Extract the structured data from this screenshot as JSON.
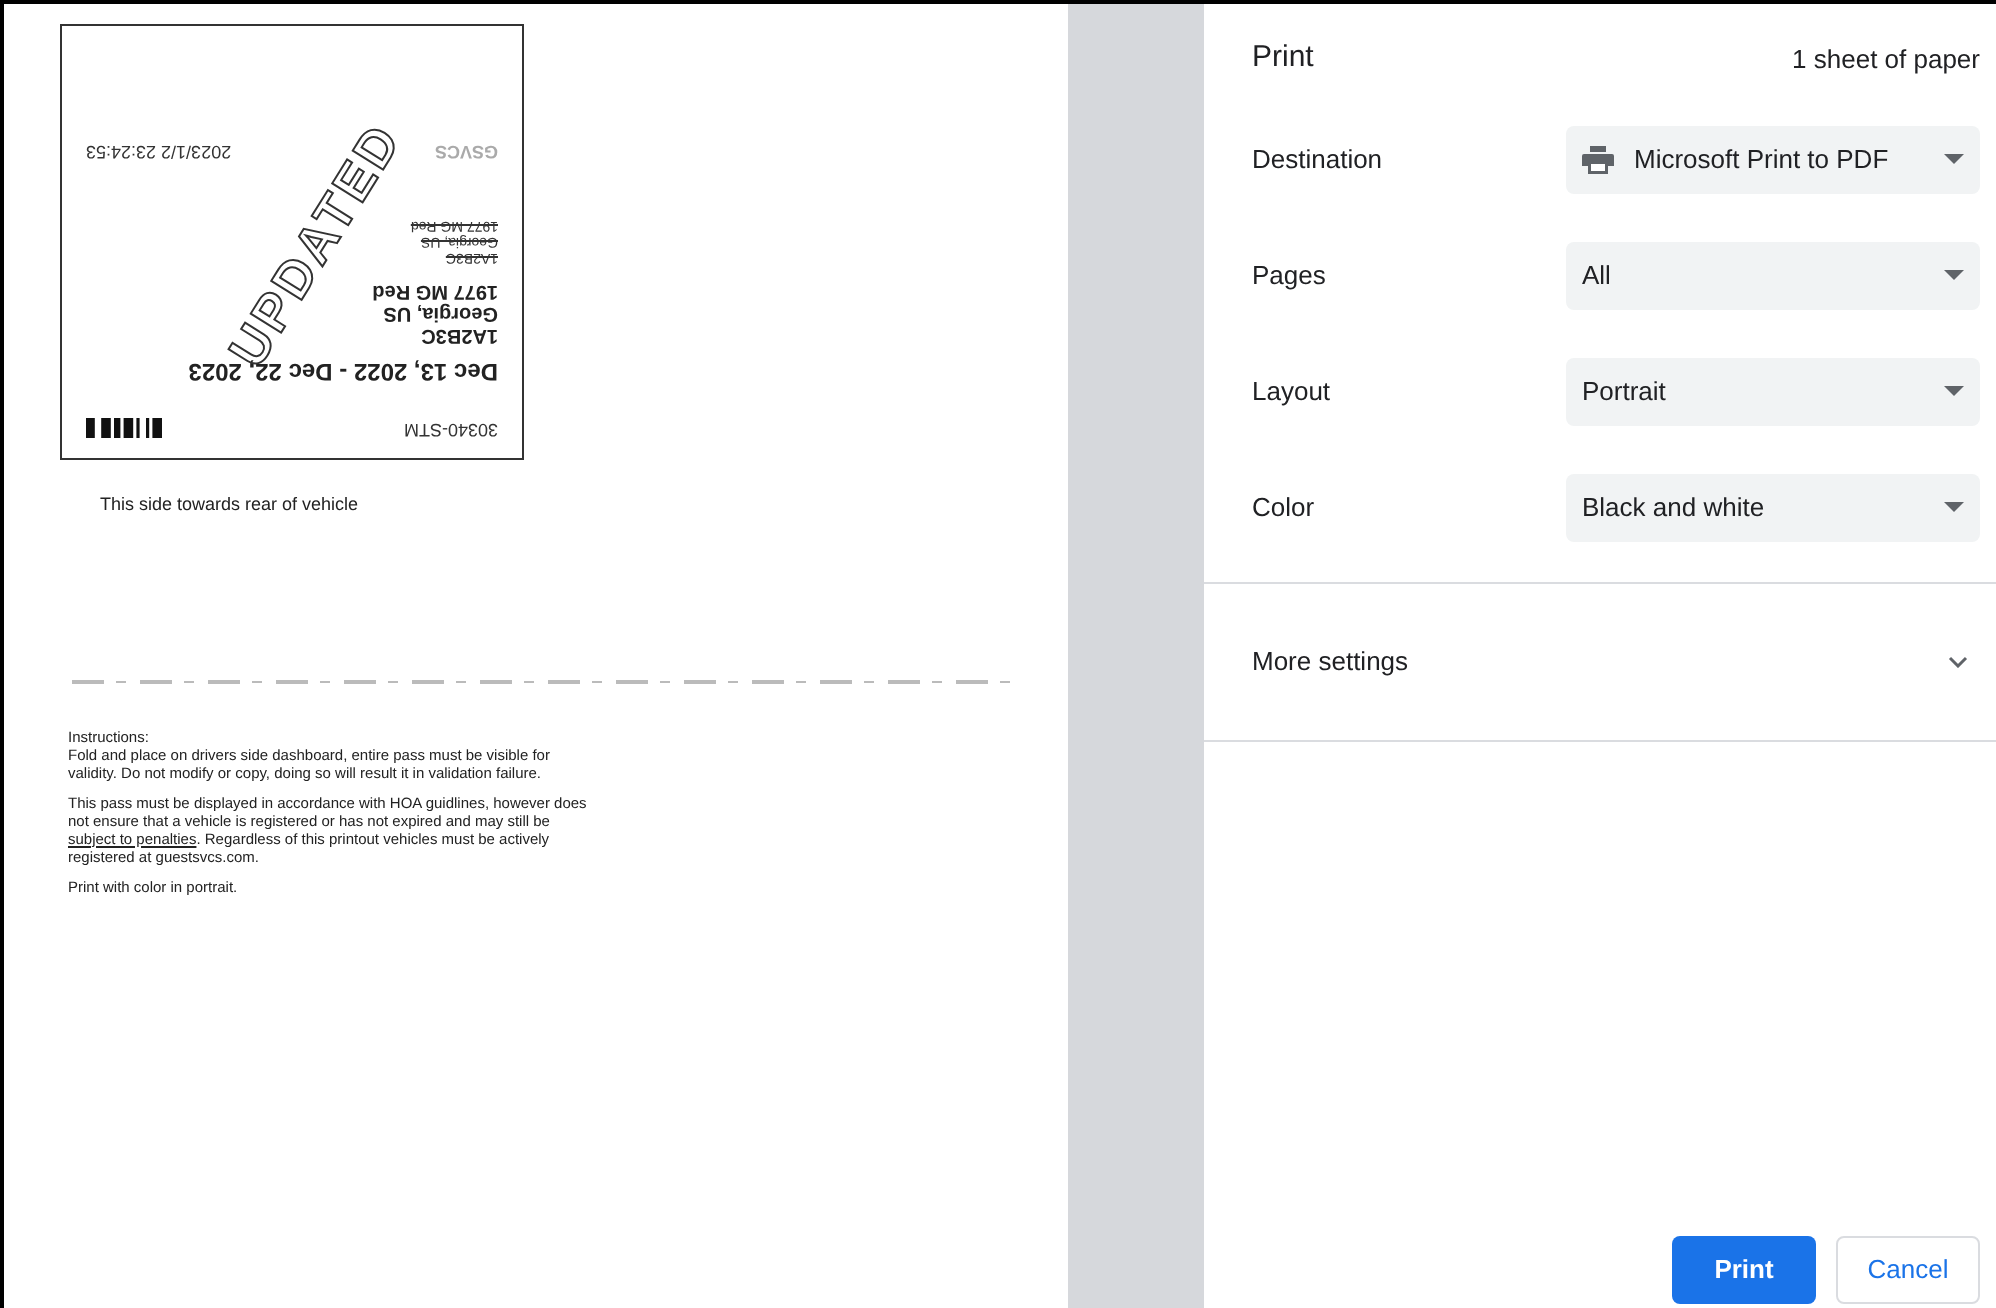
{
  "preview": {
    "pass": {
      "issuer": "GSVCS",
      "timestamp": "2023/1/2 23:24:53",
      "old_lines": [
        "1A2B3C",
        "Georgia, US",
        "1977 MG Red"
      ],
      "lines": [
        "1A2B3C",
        "Georgia, US",
        "1977 MG Red"
      ],
      "validity": "Dec 13, 2022 - Dec 22, 2023",
      "pass_id": "30340-STM",
      "stamp": "UPDATED"
    },
    "side_note": "This side towards rear of vehicle",
    "instructions_title": "Instructions:",
    "paragraphs": [
      {
        "text": "Fold and place on drivers side dashboard, entire pass must be visible for validity. Do not modify or copy, doing so will result it in validation failure."
      },
      {
        "text": "This pass must be displayed in accordance with HOA guidlines, however does not ensure that a vehicle is registered or has not expired and may still be ",
        "link": "subject to penalties",
        "after": ". Regardless of this printout vehicles must be actively registered at guestsvcs.com."
      },
      {
        "text": "Print with color in portrait."
      }
    ]
  },
  "panel": {
    "title": "Print",
    "sheets": "1 sheet of paper",
    "settings": [
      {
        "label": "Destination",
        "value": "Microsoft Print to PDF",
        "kind": "printer"
      },
      {
        "label": "Pages",
        "value": "All",
        "kind": "plain"
      },
      {
        "label": "Layout",
        "value": "Portrait",
        "kind": "plain"
      },
      {
        "label": "Color",
        "value": "Black and white",
        "kind": "plain"
      }
    ],
    "more_settings": {
      "label": "More settings",
      "expanded": false
    },
    "buttons": [
      {
        "label": "Print",
        "kind": "primary"
      },
      {
        "label": "Cancel",
        "kind": "secondary"
      }
    ]
  }
}
